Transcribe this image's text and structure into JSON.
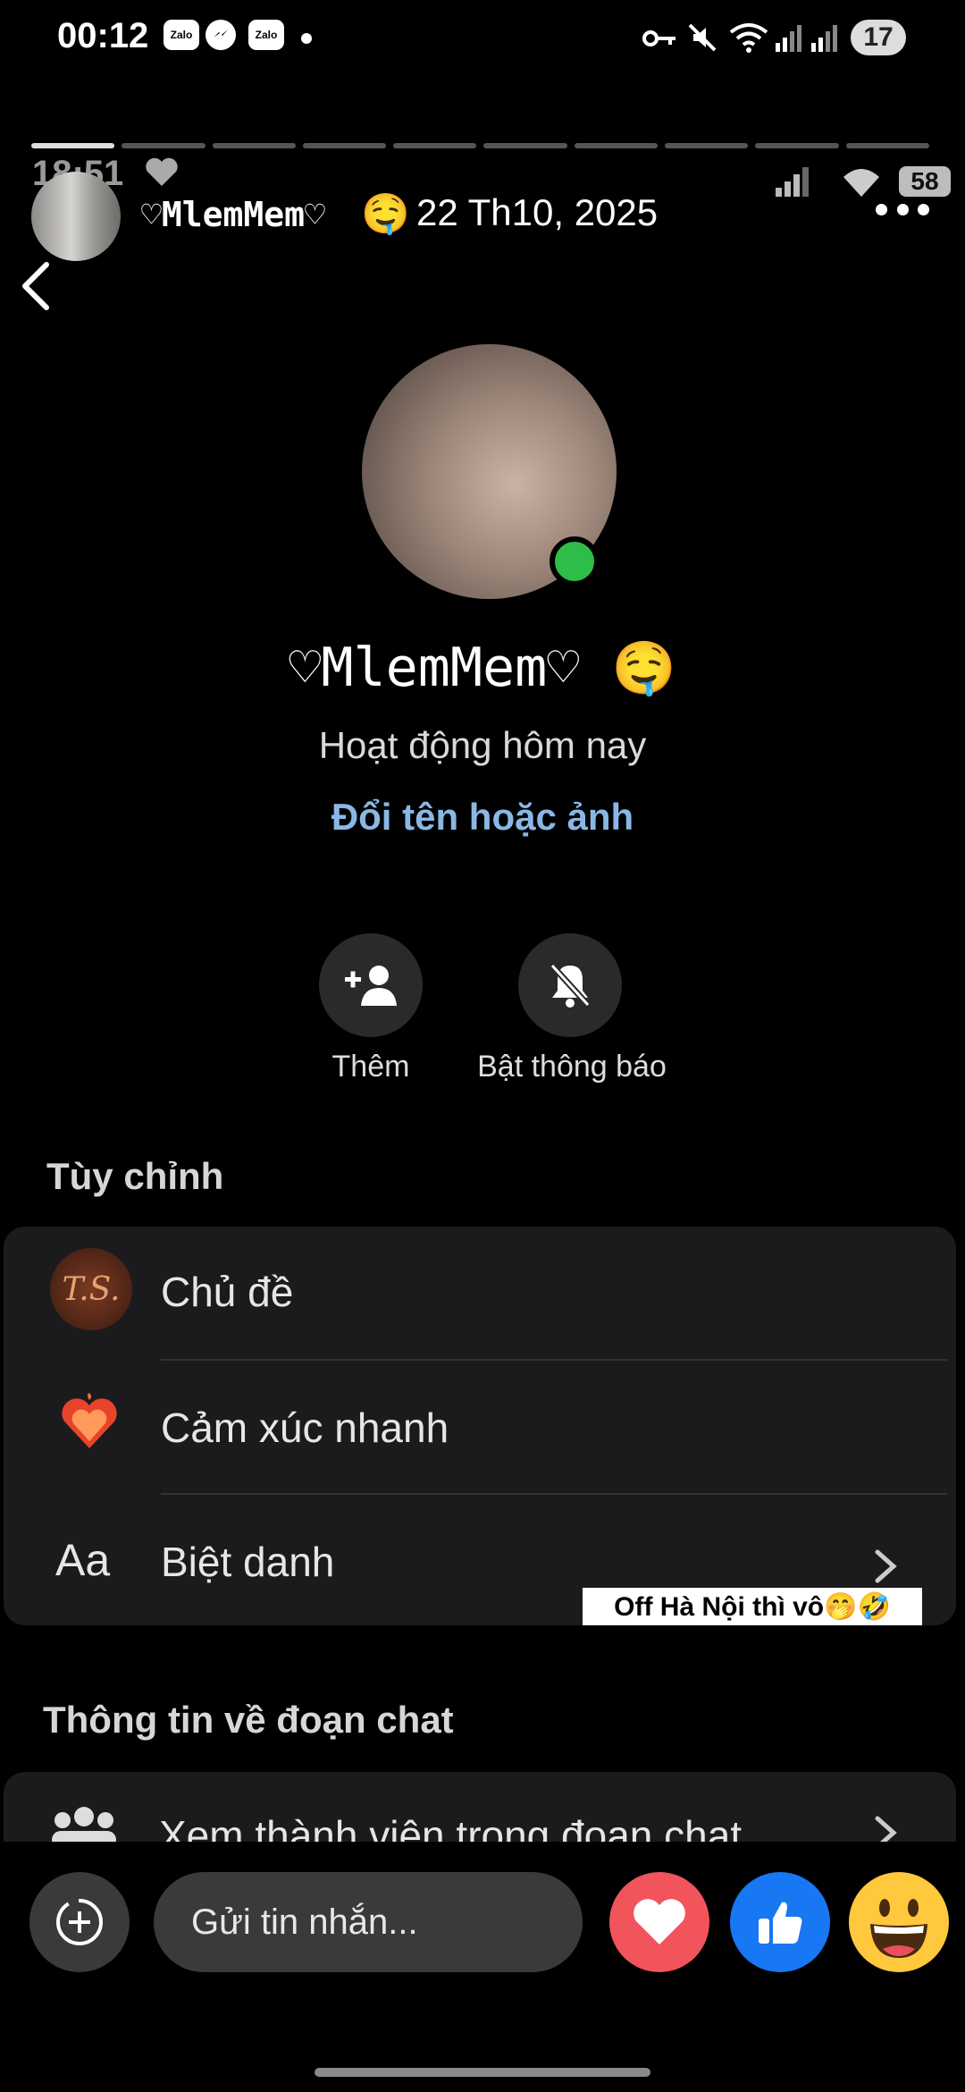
{
  "status_bar": {
    "time": "00:12",
    "app_icons": [
      "Zalo",
      "messenger-icon",
      "Zalo"
    ],
    "battery": "17"
  },
  "story": {
    "segments_total": 10,
    "segments_active": 1,
    "username": "♡MlemMem♡",
    "username_emoji": "🤤",
    "date": "22 Th10, 2025"
  },
  "recorded_screen": {
    "time": "18:51",
    "battery": "58",
    "profile_name": "♡MlemMem♡",
    "profile_emoji": "🤤",
    "activity_status": "Hoạt động hôm nay",
    "rename_link": "Đổi tên hoặc ảnh",
    "actions": {
      "add_label": "Thêm",
      "notify_label": "Bật thông báo"
    },
    "customize": {
      "title": "Tùy chỉnh",
      "theme_label": "Chủ đề",
      "theme_badge": "T.S.",
      "quick_reaction_label": "Cảm xúc nhanh",
      "nickname_icon": "Aa",
      "nickname_label": "Biệt danh"
    },
    "chat_info": {
      "title": "Thông tin về đoạn chat",
      "members_label": "Xem thành viên trong đoạn chat"
    }
  },
  "caption": "Off Hà Nội thì vô🤭🤣",
  "composer": {
    "placeholder": "Gửi tin nhắn..."
  },
  "colors": {
    "online": "#2fbd4a",
    "link": "#8ab8e6",
    "heart": "#f2545b",
    "like": "#1877f2"
  }
}
